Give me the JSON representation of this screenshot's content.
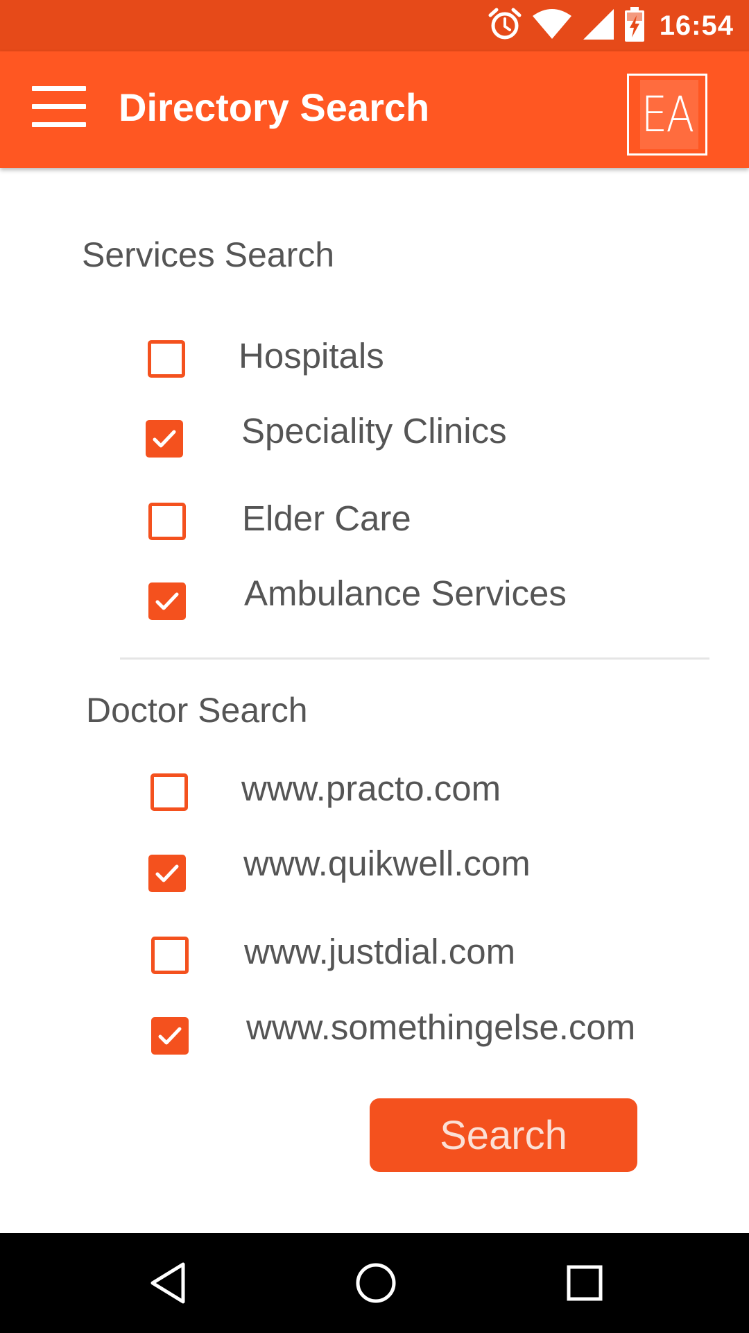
{
  "status_bar": {
    "time": "16:54",
    "icons": [
      "alarm-icon",
      "wifi-icon",
      "signal-icon",
      "battery-charging-icon"
    ]
  },
  "app_bar": {
    "title": "Directory Search",
    "menu_icon": "hamburger-menu-icon",
    "logo_text": "EA"
  },
  "services": {
    "heading": "Services Search",
    "options": [
      {
        "label": "Hospitals",
        "checked": false
      },
      {
        "label": "Speciality Clinics",
        "checked": true
      },
      {
        "label": "Elder Care",
        "checked": false
      },
      {
        "label": "Ambulance Services",
        "checked": true
      }
    ]
  },
  "doctors": {
    "heading": "Doctor Search",
    "options": [
      {
        "label": "www.practo.com",
        "checked": false
      },
      {
        "label": "www.quikwell.com",
        "checked": true
      },
      {
        "label": "www.justdial.com",
        "checked": false
      },
      {
        "label": "www.somethingelse.com",
        "checked": true
      }
    ]
  },
  "search_button": {
    "label": "Search"
  },
  "nav_bar": {
    "buttons": [
      "back-icon",
      "home-icon",
      "recents-icon"
    ]
  },
  "colors": {
    "status_bar": "#e64a19",
    "app_bar": "#ff5722",
    "accent": "#f4511e",
    "text": "#555555",
    "nav_bar": "#000000"
  }
}
